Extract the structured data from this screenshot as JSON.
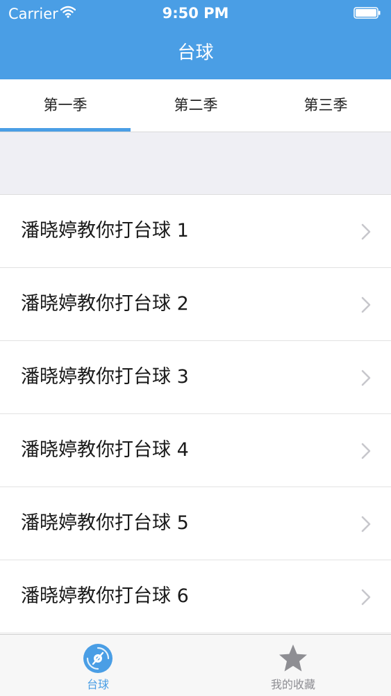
{
  "status_bar": {
    "carrier": "Carrier",
    "time": "9:50 PM",
    "icons": [
      "wifi-icon",
      "battery-icon"
    ]
  },
  "nav": {
    "title": "台球"
  },
  "tabs": [
    {
      "label": "第一季",
      "selected": true
    },
    {
      "label": "第二季",
      "selected": false
    },
    {
      "label": "第三季",
      "selected": false
    }
  ],
  "list": {
    "items": [
      {
        "label": "潘晓婷教你打台球 1"
      },
      {
        "label": "潘晓婷教你打台球 2"
      },
      {
        "label": "潘晓婷教你打台球 3"
      },
      {
        "label": "潘晓婷教你打台球 4"
      },
      {
        "label": "潘晓婷教你打台球 5"
      },
      {
        "label": "潘晓婷教你打台球 6"
      }
    ],
    "accessory_icon": "chevron-right-icon"
  },
  "tabbar": {
    "items": [
      {
        "label": "台球",
        "icon": "disc-icon",
        "selected": true
      },
      {
        "label": "我的收藏",
        "icon": "star-icon",
        "selected": false
      }
    ]
  },
  "colors": {
    "accent": "#4a9ee5",
    "inactive": "#8e8e93",
    "text": "#1a1a1a",
    "background": "#efeff4"
  }
}
